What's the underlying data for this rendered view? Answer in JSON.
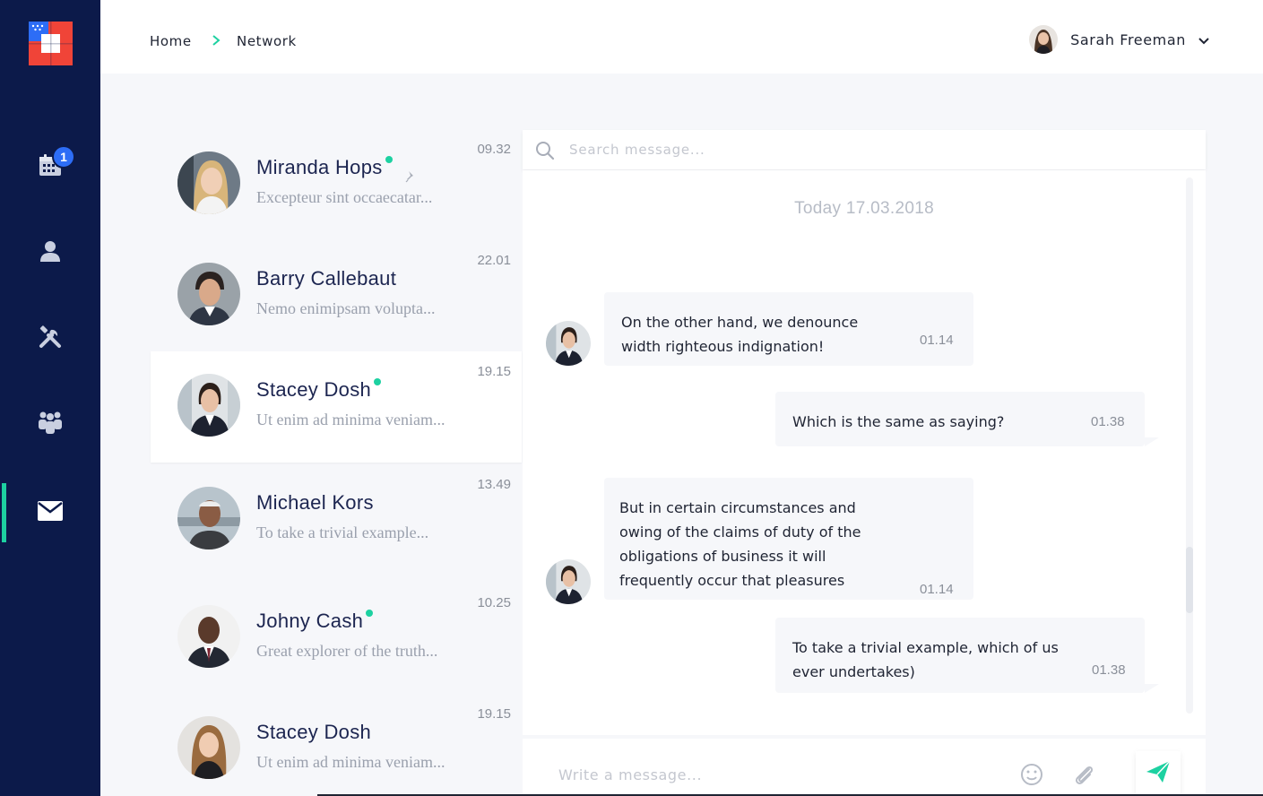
{
  "breadcrumb": {
    "home": "Home",
    "current": "Network"
  },
  "user": {
    "name": "Sarah Freeman"
  },
  "sidebar": {
    "badge_count": "1",
    "items": [
      {
        "icon": "calendar-icon"
      },
      {
        "icon": "user-icon"
      },
      {
        "icon": "tools-icon"
      },
      {
        "icon": "team-icon"
      },
      {
        "icon": "mail-icon",
        "active": true
      }
    ]
  },
  "contacts": [
    {
      "name": "Miranda Hops",
      "preview": "Excepteur sint occaecatar...",
      "time": "09.32",
      "online": true,
      "pinned": true
    },
    {
      "name": "Barry Callebaut",
      "preview": "Nemo enimipsam volupta...",
      "time": "22.01",
      "online": false
    },
    {
      "name": "Stacey Dosh",
      "preview": "Ut enim ad minima veniam...",
      "time": "19.15",
      "online": true,
      "active": true
    },
    {
      "name": "Michael Kors",
      "preview": "To take a trivial example...",
      "time": "13.49",
      "online": false
    },
    {
      "name": "Johny Cash",
      "preview": "Great explorer of the truth...",
      "time": "10.25",
      "online": true
    },
    {
      "name": "Stacey Dosh",
      "preview": "Ut enim ad minima veniam...",
      "time": "19.15",
      "online": false
    }
  ],
  "search": {
    "placeholder": "Search message..."
  },
  "chat": {
    "date": "Today 17.03.2018",
    "messages": [
      {
        "from": "contact",
        "lines": [
          "On the other hand, we denounce",
          "width righteous indignation!"
        ],
        "time": "01.14"
      },
      {
        "from": "me",
        "lines": [
          "Which is the same as saying?"
        ],
        "time": "01.38"
      },
      {
        "from": "contact",
        "lines": [
          "But in certain circumstances and",
          "owing of the claims of duty of the",
          "obligations of business it will",
          "frequently occur that pleasures"
        ],
        "time": "01.14"
      },
      {
        "from": "me",
        "lines": [
          "To take a trivial example, which of us",
          "ever undertakes)"
        ],
        "time": "01.38"
      }
    ]
  },
  "composer": {
    "placeholder": "Write a message..."
  },
  "colors": {
    "sidebar": "#0c1a4a",
    "accent": "#1dd1a1",
    "badge": "#2d6df6"
  }
}
